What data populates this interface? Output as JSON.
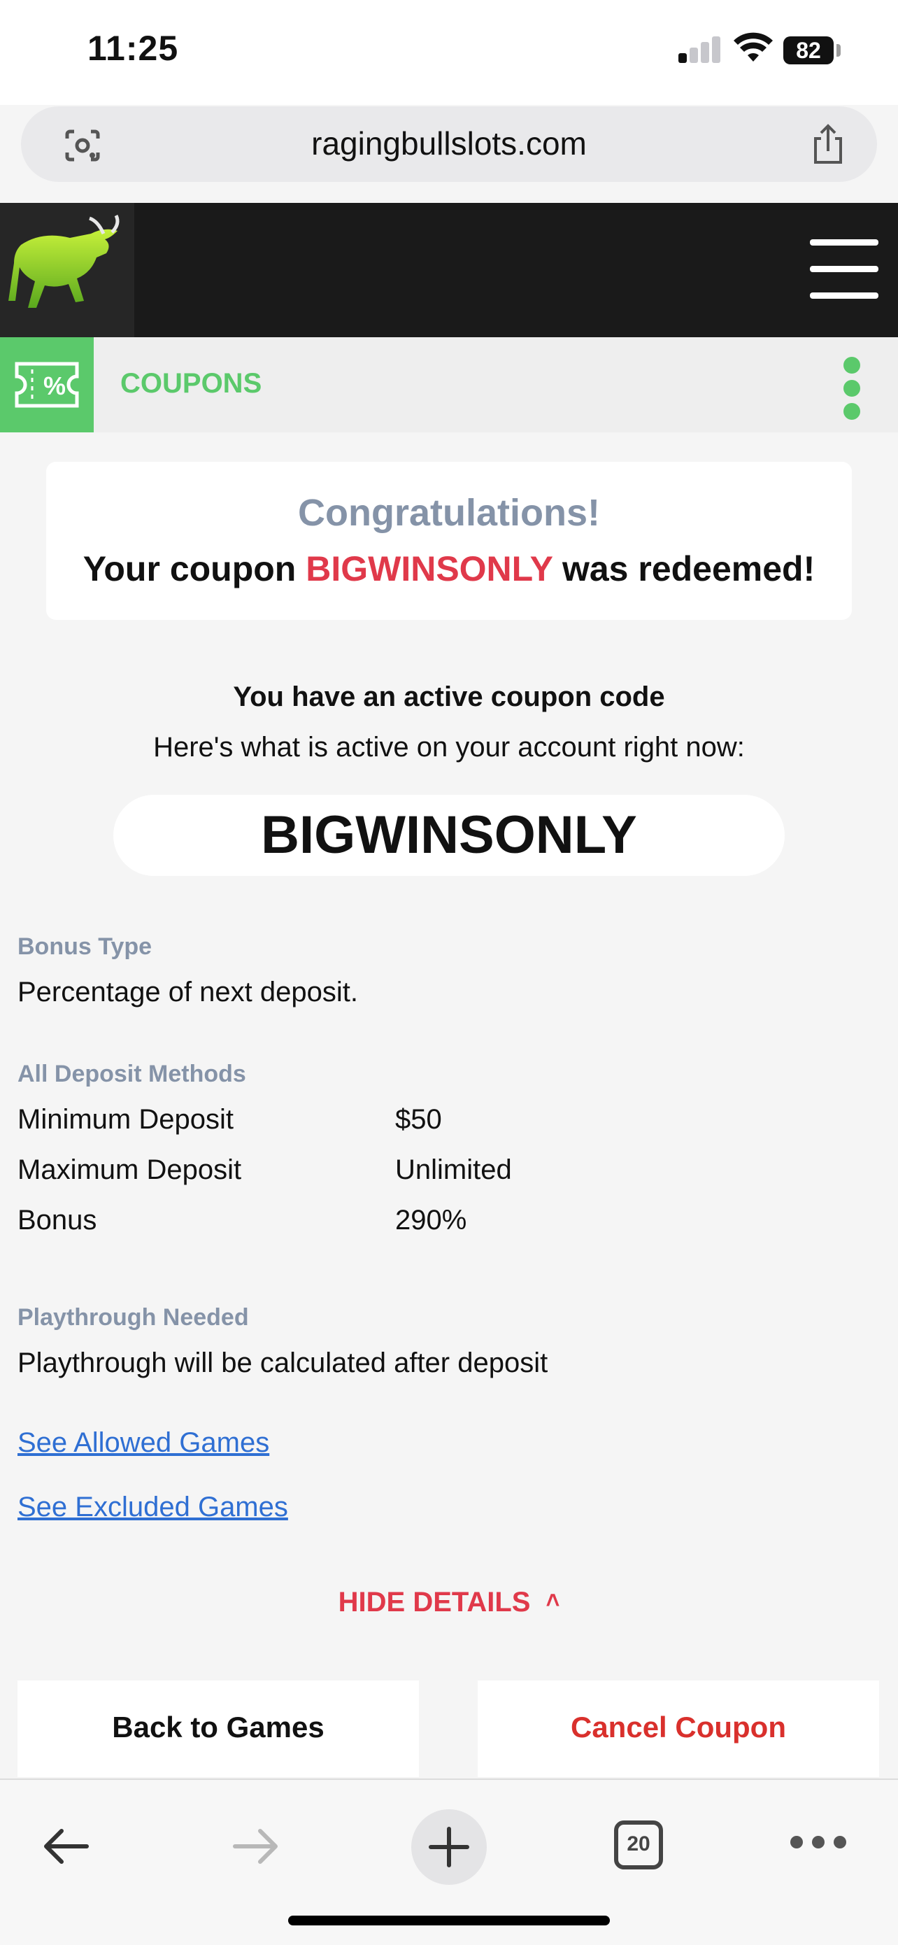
{
  "status_bar": {
    "time": "11:25",
    "battery": "82",
    "icons": [
      "signal-icon",
      "wifi-icon",
      "battery-icon"
    ]
  },
  "browser": {
    "url": "ragingbullslots.com",
    "icons": [
      "camera-search-icon",
      "share-icon"
    ]
  },
  "site_header": {
    "logo": "bull-logo",
    "menu_icon": "hamburger-menu-icon"
  },
  "coupons_bar": {
    "label": "COUPONS",
    "icon": "coupon-percent-icon",
    "more_icon": "kebab-menu-icon"
  },
  "message": {
    "congratulations": "Congratulations!",
    "redeemed_prefix": "Your coupon ",
    "code": "BIGWINSONLY",
    "redeemed_suffix": " was redeemed!"
  },
  "active": {
    "title": "You have an active coupon code",
    "subtitle": "Here's what is active on your account right now:",
    "code": "BIGWINSONLY"
  },
  "details": {
    "bonus_type_label": "Bonus Type",
    "bonus_type_value": "Percentage of next deposit.",
    "methods_label": "All Deposit Methods",
    "rows": [
      {
        "label": "Minimum Deposit",
        "value": "$50"
      },
      {
        "label": "Maximum Deposit",
        "value": "Unlimited"
      },
      {
        "label": "Bonus",
        "value": "290%"
      }
    ],
    "playthrough_label": "Playthrough Needed",
    "playthrough_value": "Playthrough will be calculated after deposit",
    "allowed_link": "See Allowed Games",
    "excluded_link": "See Excluded Games",
    "hide_details": "HIDE DETAILS"
  },
  "actions": {
    "back": "Back to Games",
    "cancel": "Cancel Coupon"
  },
  "toolbar": {
    "tab_count": "20",
    "icons": [
      "back-arrow-icon",
      "forward-arrow-icon",
      "new-tab-plus-icon",
      "tabs-icon",
      "more-icon"
    ]
  },
  "colors": {
    "accent_green": "#5bc96b",
    "accent_red": "#e0394a",
    "link_blue": "#2f6fd3",
    "label_gray": "#8593a8"
  }
}
